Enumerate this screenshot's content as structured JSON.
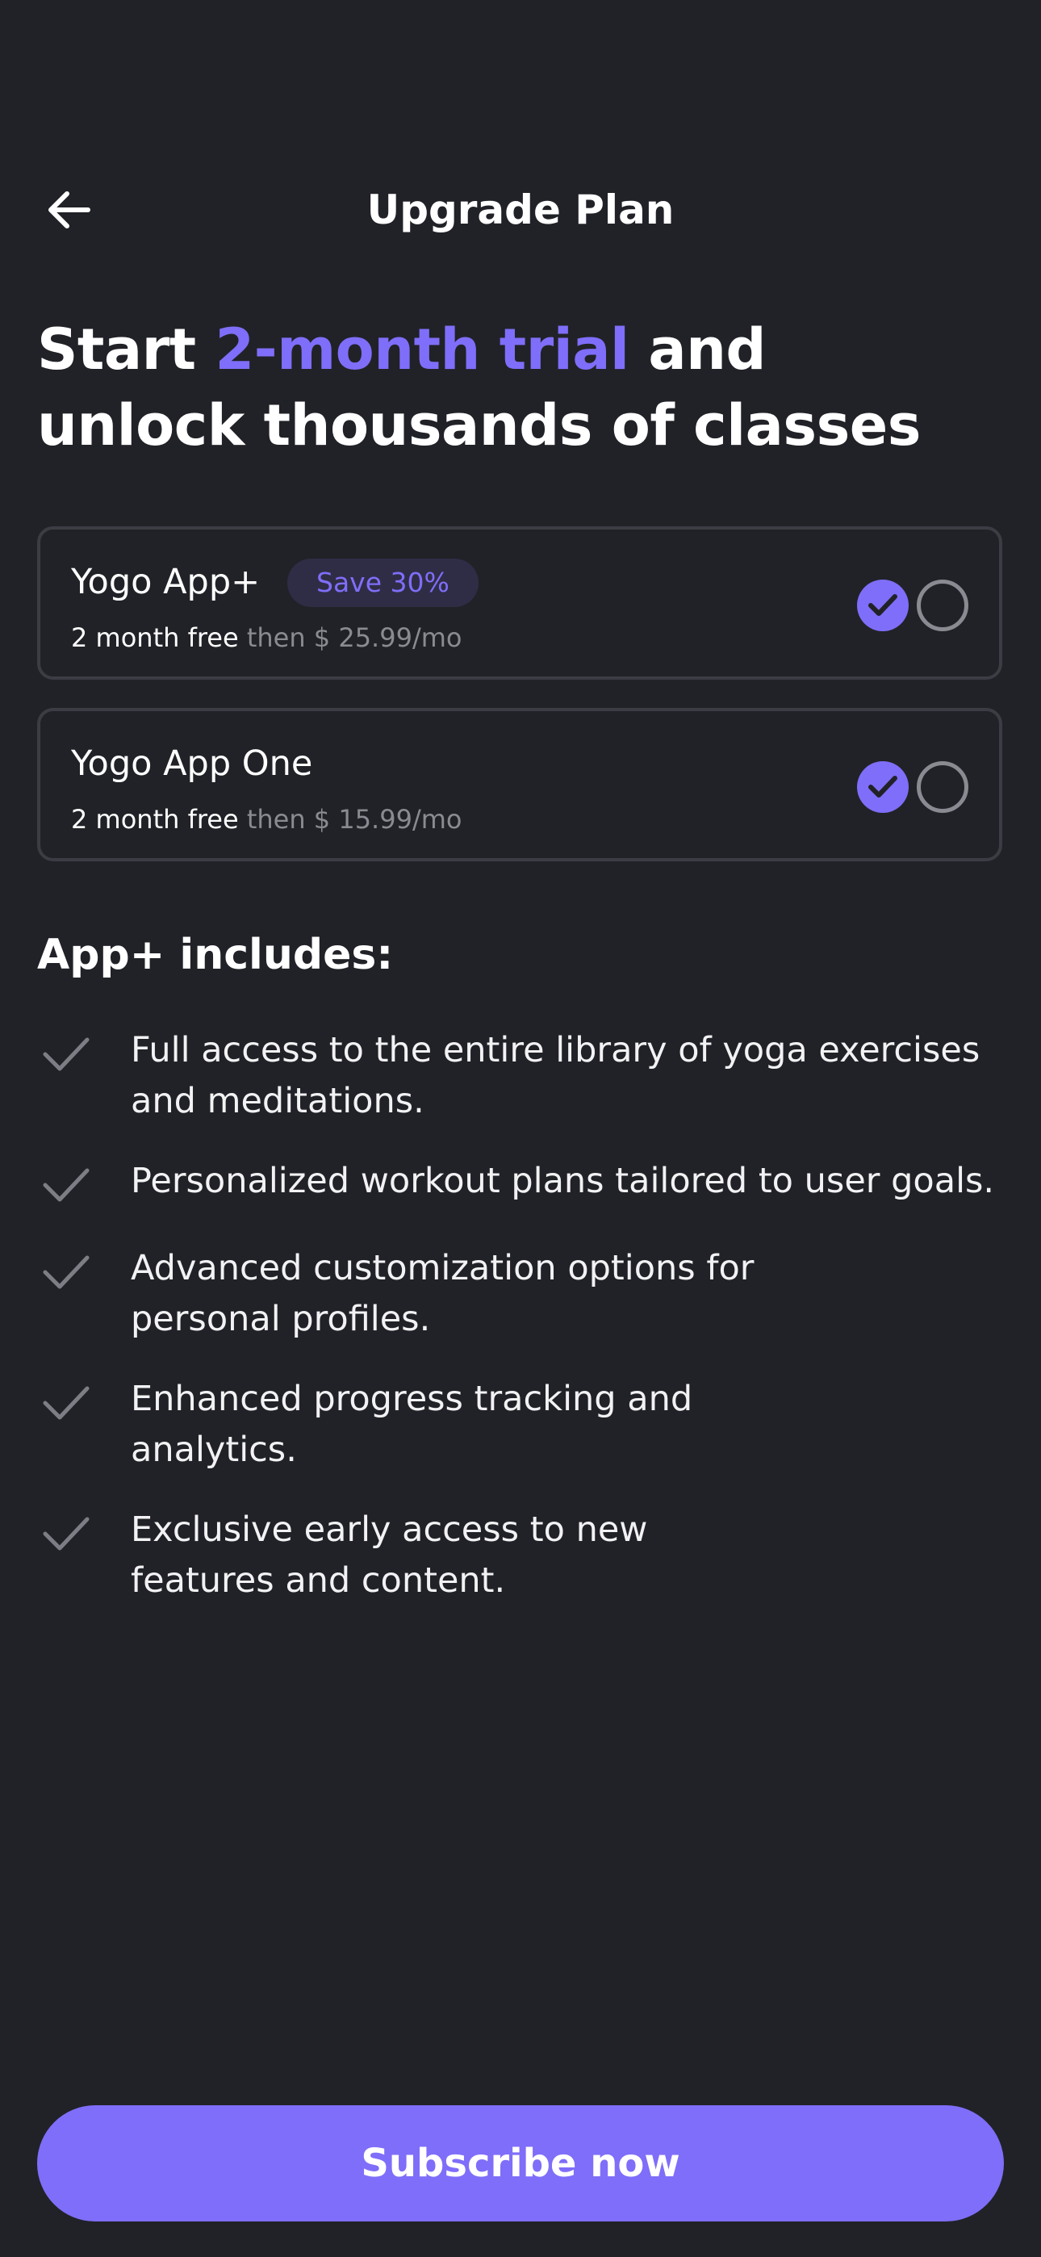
{
  "header": {
    "title": "Upgrade Plan",
    "back_icon": "arrow-left-icon"
  },
  "headline": {
    "part1": "Start ",
    "accent": "2-month trial",
    "part2": " and unlock thousands of classes"
  },
  "plans": [
    {
      "name": "Yogo App+",
      "badge": "Save 30%",
      "free_text": "2 month free",
      "then_text": " then $ 25.99/mo",
      "selected": true
    },
    {
      "name": "Yogo App One",
      "free_text": "2 month free",
      "then_text": " then $ 15.99/mo",
      "selected": true
    }
  ],
  "includes": {
    "title": "App+ includes:",
    "features": [
      {
        "line1": "Full access to the entire library of yoga exercises",
        "line2": "and meditations."
      },
      {
        "line1": "Personalized workout plans tailored to user goals.",
        "line2": ""
      },
      {
        "line1": "Advanced customization options for",
        "line2": "personal profiles."
      },
      {
        "line1": "Enhanced progress tracking and",
        "line2": "analytics."
      },
      {
        "line1": "Exclusive early access to new",
        "line2": "features and content."
      }
    ]
  },
  "cta": {
    "label": "Subscribe now"
  },
  "colors": {
    "background": "#212227",
    "accent": "#7f6ef9",
    "muted": "#8a8b92",
    "border": "#3c3d44"
  }
}
